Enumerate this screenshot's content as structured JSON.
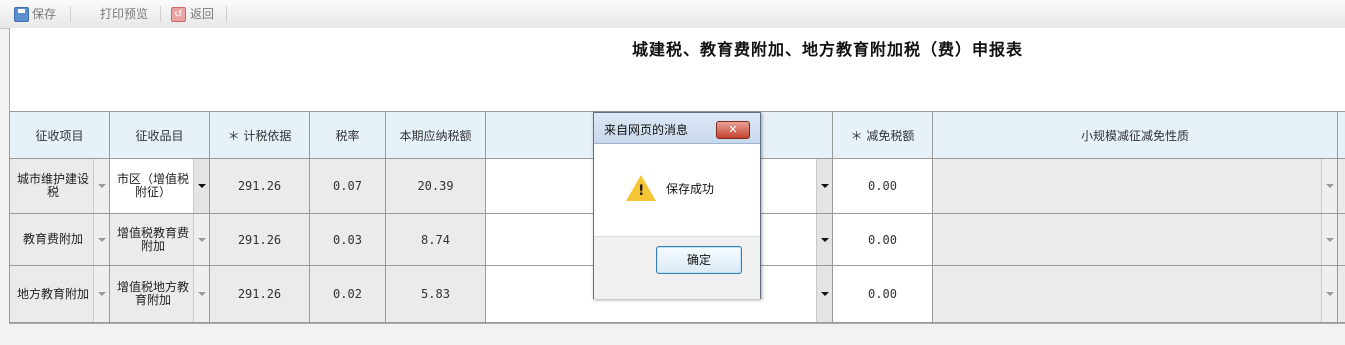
{
  "toolbar": {
    "save_label": "保存",
    "print_label": "打印预览",
    "back_label": "返回"
  },
  "form": {
    "title": "城建税、教育费附加、地方教育附加税（费）申报表"
  },
  "table": {
    "headers": [
      "征收项目",
      "征收品目",
      "＊ 计税依据",
      "税率",
      "本期应纳税额",
      "＊ 减免税额",
      "小规模减征减免性质"
    ],
    "rows": [
      {
        "item": "城市维护建设税",
        "category": "市区（增值税附征）",
        "base": "291.26",
        "rate": "0.07",
        "tax": "20.39",
        "relief": "0.00"
      },
      {
        "item": "教育费附加",
        "category": "增值税教育费附加",
        "base": "291.26",
        "rate": "0.03",
        "tax": "8.74",
        "relief": "0.00"
      },
      {
        "item": "地方教育附加",
        "category": "增值税地方教育附加",
        "base": "291.26",
        "rate": "0.02",
        "tax": "5.83",
        "relief": "0.00"
      }
    ]
  },
  "dialog": {
    "title": "来自网页的消息",
    "message": "保存成功",
    "ok_label": "确定",
    "icon": "warning-icon"
  }
}
